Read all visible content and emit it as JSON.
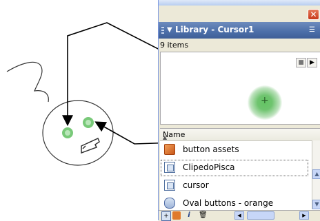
{
  "window": {
    "title": "Library - Cursor1",
    "item_count": "9 items",
    "column_name": "Name"
  },
  "close_glyph": "✕",
  "options_glyph": "☰",
  "preview": {
    "stop_glyph": "■",
    "play_glyph": "▶",
    "crosshair_glyph": "+"
  },
  "items": [
    {
      "label": "button assets",
      "icon": "folder-icon"
    },
    {
      "label": "ClipedoPisca",
      "icon": "movieclip-icon"
    },
    {
      "label": "cursor",
      "icon": "movieclip-icon"
    },
    {
      "label": "Oval buttons - orange",
      "icon": "button-symbol-icon"
    }
  ],
  "toolbar": [
    "new-symbol-icon",
    "new-folder-icon",
    "properties-icon",
    "delete-icon"
  ],
  "colors": {
    "title_bar": "#4b6ea8",
    "glow": "#63c463",
    "folder": "#c8581a"
  }
}
